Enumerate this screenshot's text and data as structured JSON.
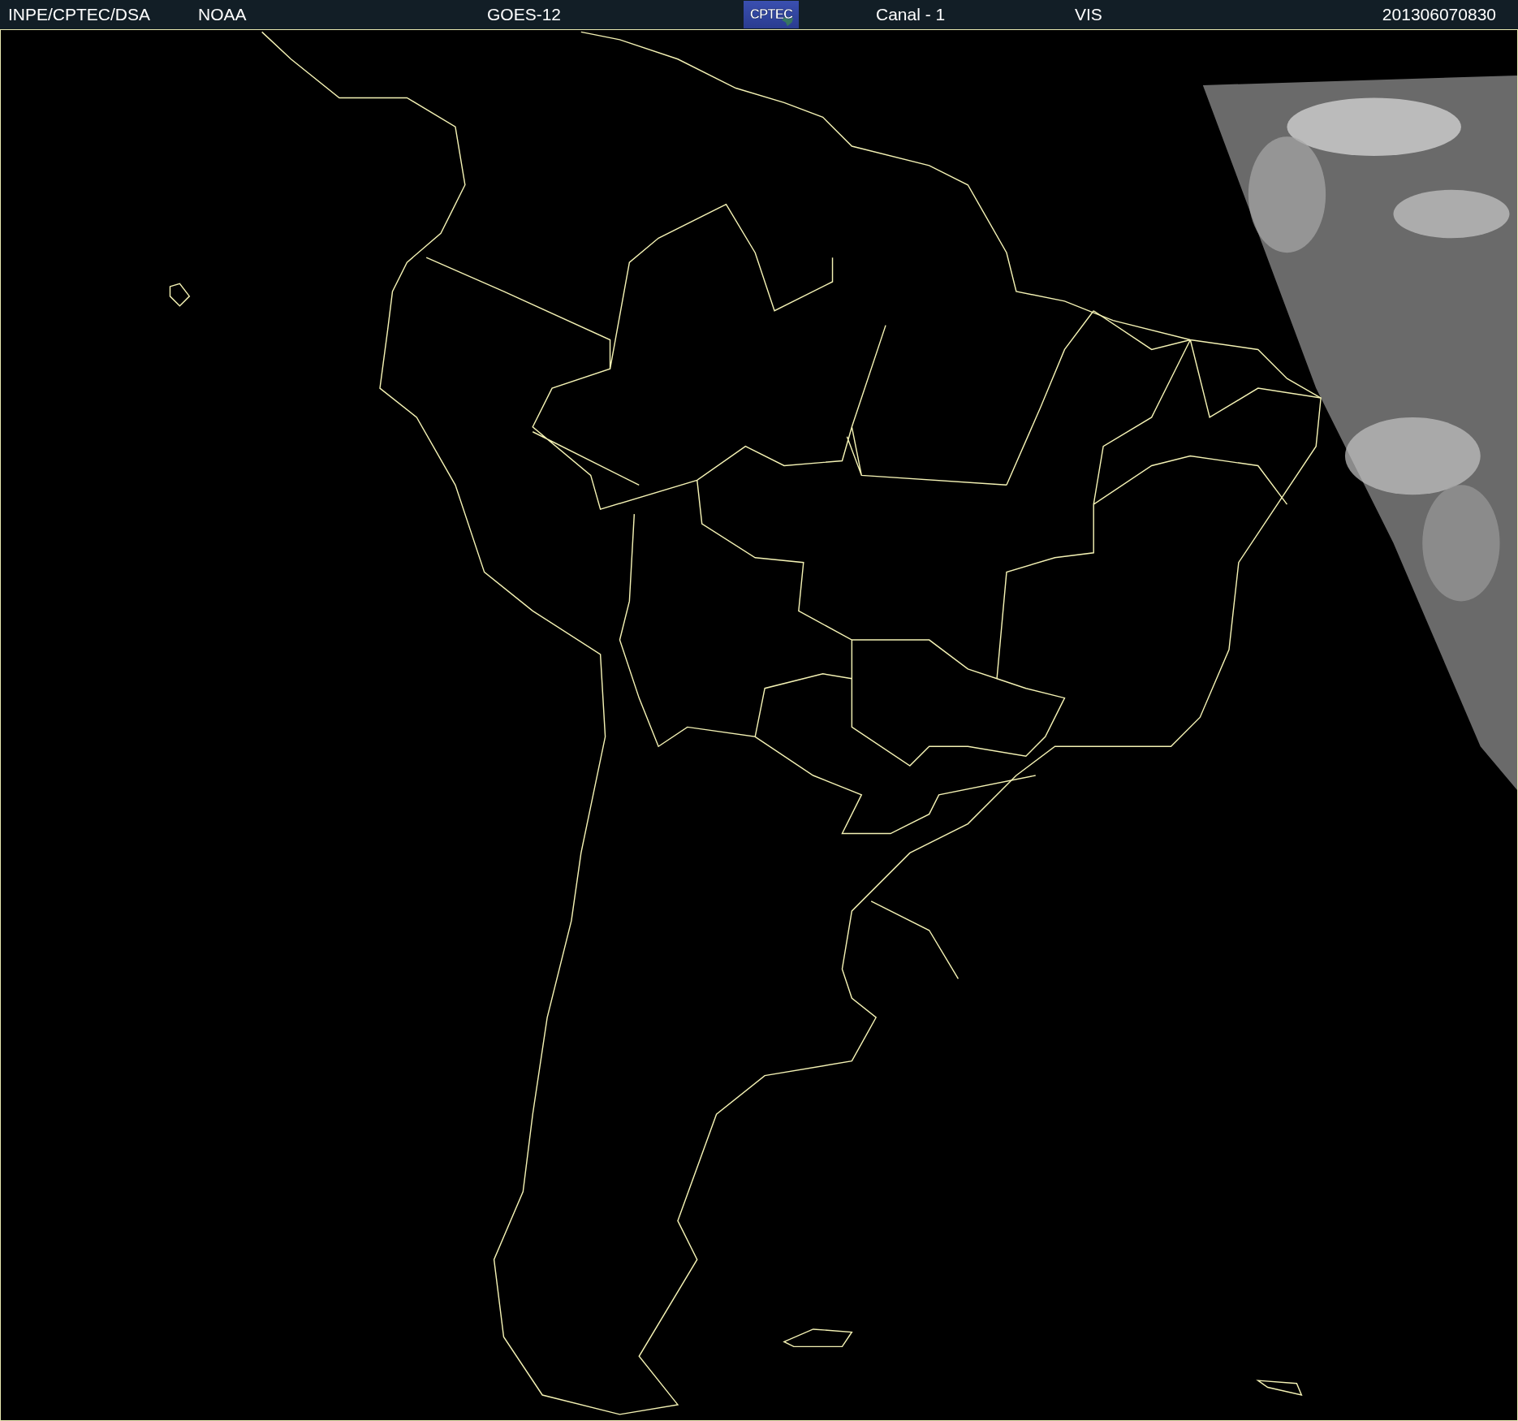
{
  "header": {
    "items": [
      {
        "kind": "text",
        "text": "INPE/CPTEC/DSA"
      },
      {
        "kind": "text",
        "text": "NOAA"
      },
      {
        "kind": "text",
        "text": "GOES-12"
      },
      {
        "kind": "logo",
        "text": "CPTEC"
      },
      {
        "kind": "text",
        "text": "Canal - 1"
      },
      {
        "kind": "text",
        "text": "VIS"
      },
      {
        "kind": "text",
        "text": "201306070830"
      }
    ]
  }
}
